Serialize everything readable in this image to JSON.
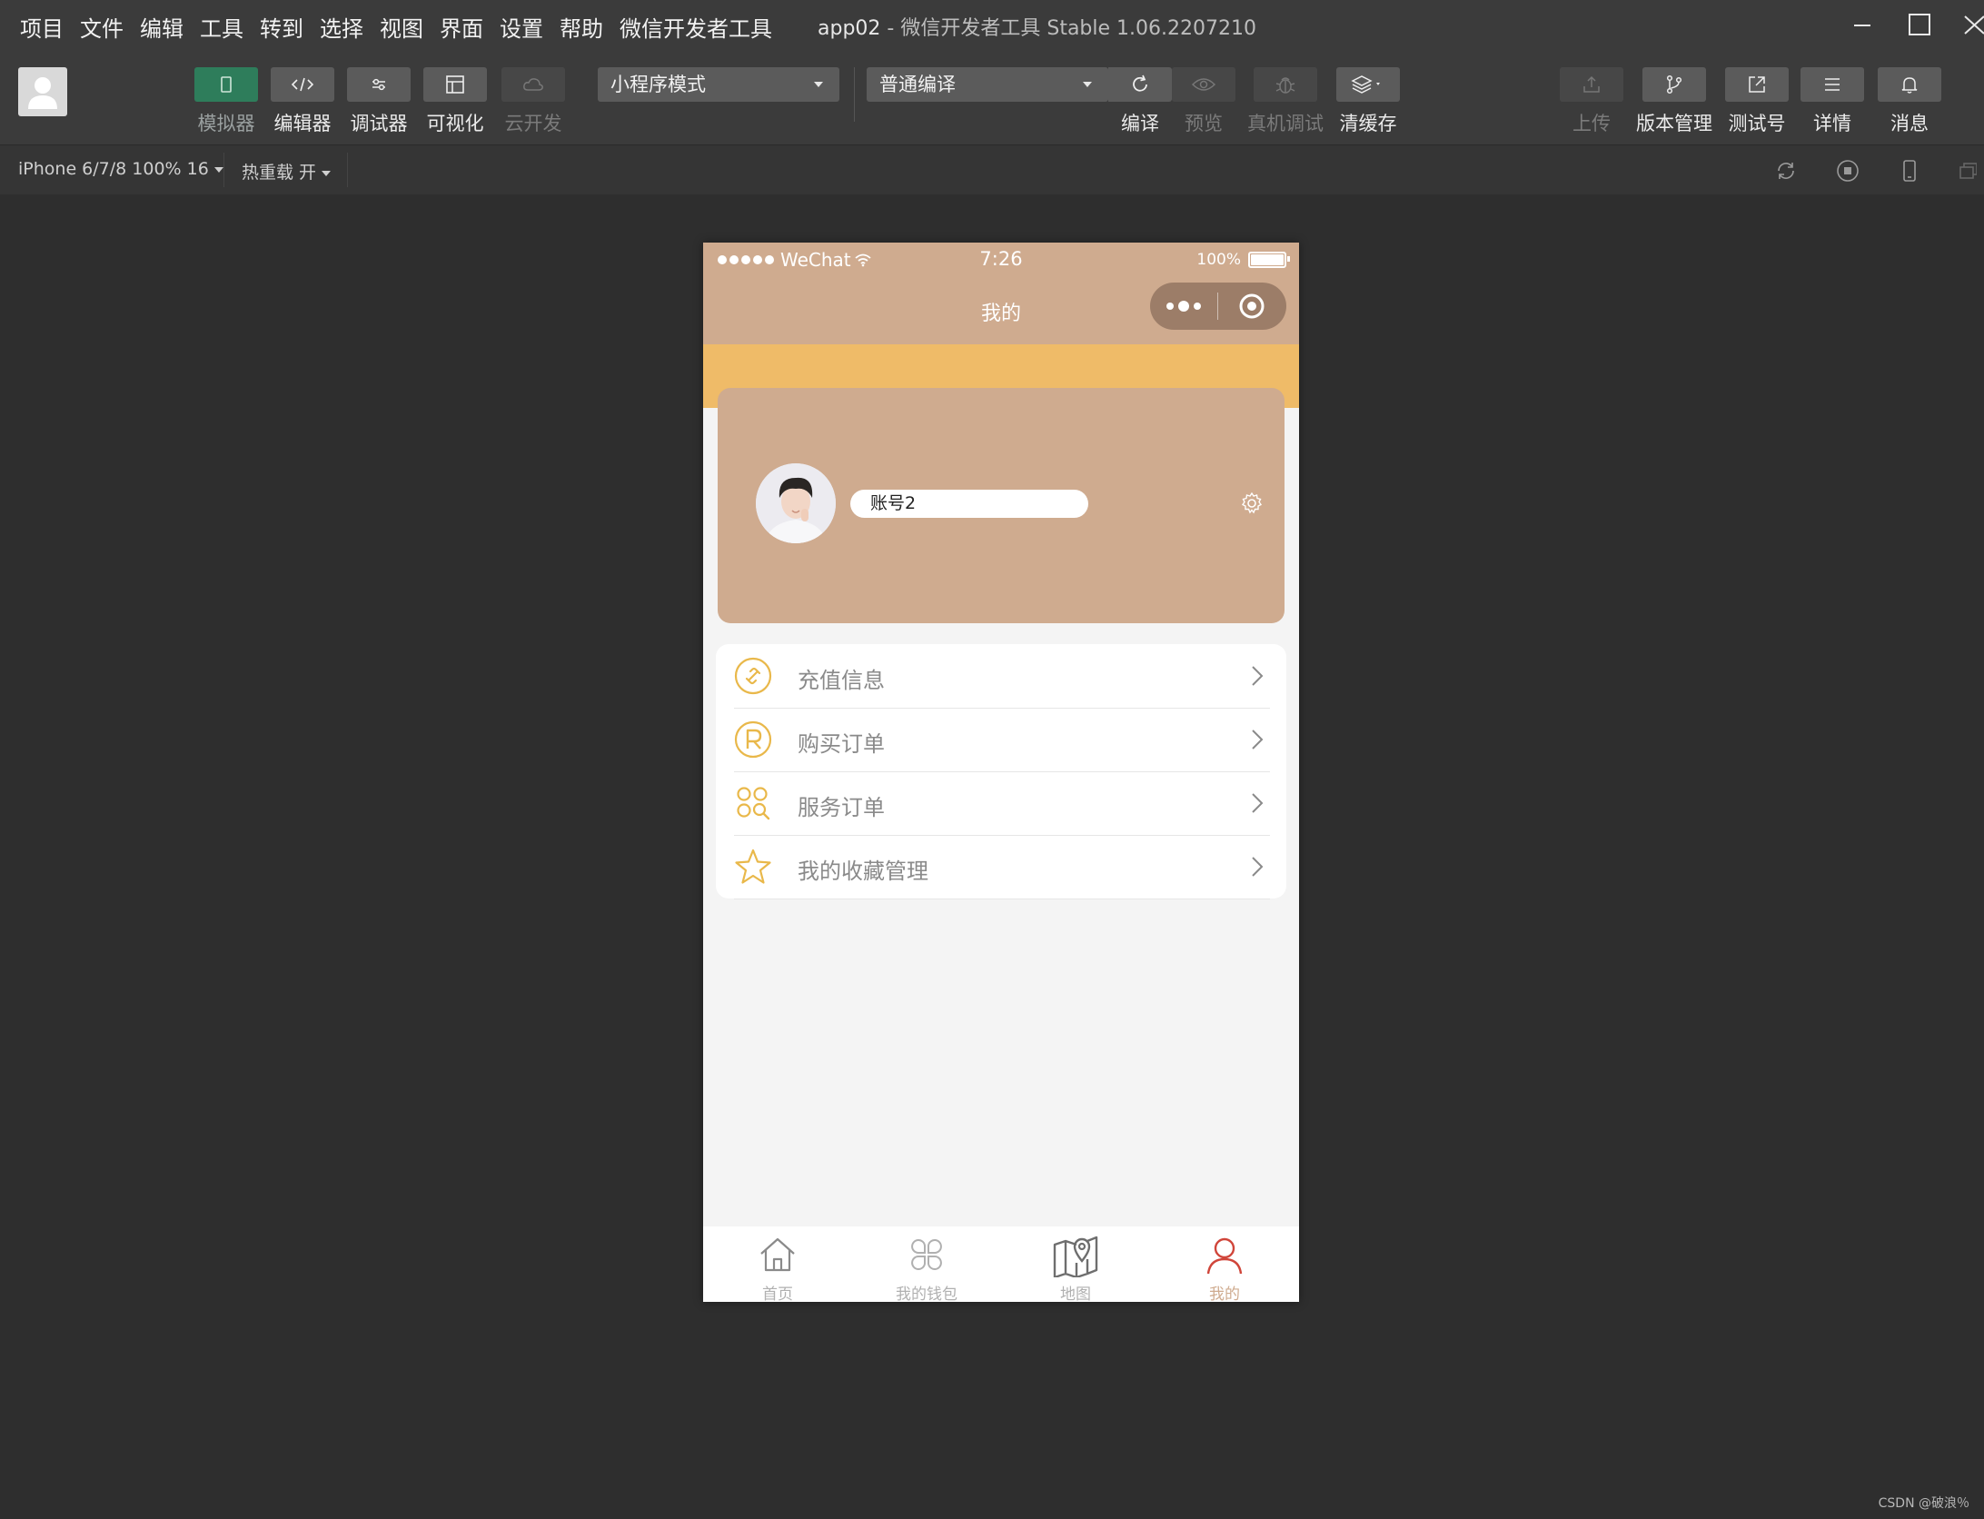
{
  "menubar": {
    "items": [
      "项目",
      "文件",
      "编辑",
      "工具",
      "转到",
      "选择",
      "视图",
      "界面",
      "设置",
      "帮助",
      "微信开发者工具"
    ],
    "app_name": "app02",
    "separator": "-",
    "tool_title": "微信开发者工具 Stable 1.06.2207210"
  },
  "toolbar": {
    "left_buttons": [
      {
        "label": "模拟器",
        "icon": "phone-icon",
        "state": "active"
      },
      {
        "label": "编辑器",
        "icon": "code-icon",
        "state": "normal"
      },
      {
        "label": "调试器",
        "icon": "sliders-icon",
        "state": "normal"
      },
      {
        "label": "可视化",
        "icon": "layout-icon",
        "state": "normal"
      },
      {
        "label": "云开发",
        "icon": "cloud-icon",
        "state": "disabled"
      }
    ],
    "mode_select": "小程序模式",
    "compile_select": "普通编译",
    "mid_buttons": [
      {
        "label": "编译",
        "icon": "refresh-icon",
        "state": "normal"
      },
      {
        "label": "预览",
        "icon": "eye-icon",
        "state": "disabled"
      },
      {
        "label": "真机调试",
        "icon": "bug-icon",
        "state": "disabled"
      },
      {
        "label": "清缓存",
        "icon": "layers-icon",
        "state": "normal"
      }
    ],
    "right_buttons": [
      {
        "label": "上传",
        "icon": "upload-icon",
        "state": "disabled"
      },
      {
        "label": "版本管理",
        "icon": "branch-icon",
        "state": "normal"
      },
      {
        "label": "测试号",
        "icon": "external-link-icon",
        "state": "normal"
      },
      {
        "label": "详情",
        "icon": "menu-icon",
        "state": "normal"
      },
      {
        "label": "消息",
        "icon": "bell-icon",
        "state": "normal"
      }
    ]
  },
  "devbar": {
    "device": "iPhone 6/7/8 100% 16",
    "hot_reload": "热重载 开"
  },
  "phone": {
    "status": {
      "carrier": "WeChat",
      "time": "7:26",
      "battery": "100%"
    },
    "nav_title": "我的",
    "username": "账号2",
    "menu": [
      {
        "label": "充值信息",
        "icon": "link-circle-icon"
      },
      {
        "label": "购买订单",
        "icon": "registered-circle-icon"
      },
      {
        "label": "服务订单",
        "icon": "grid-search-icon"
      },
      {
        "label": "我的收藏管理",
        "icon": "star-icon"
      }
    ],
    "tabs": [
      {
        "label": "首页",
        "icon": "home-icon",
        "active": false
      },
      {
        "label": "我的钱包",
        "icon": "clover-icon",
        "active": false
      },
      {
        "label": "地图",
        "icon": "map-icon",
        "active": false
      },
      {
        "label": "我的",
        "icon": "person-icon",
        "active": true
      }
    ]
  },
  "colors": {
    "accent_green": "#2e7d5b",
    "nav_tan": "#cfab8f",
    "band_yellow": "#efbb68",
    "icon_gold": "#e9b84a",
    "active_tab": "#d0453a"
  },
  "credit": "CSDN @破浪％"
}
